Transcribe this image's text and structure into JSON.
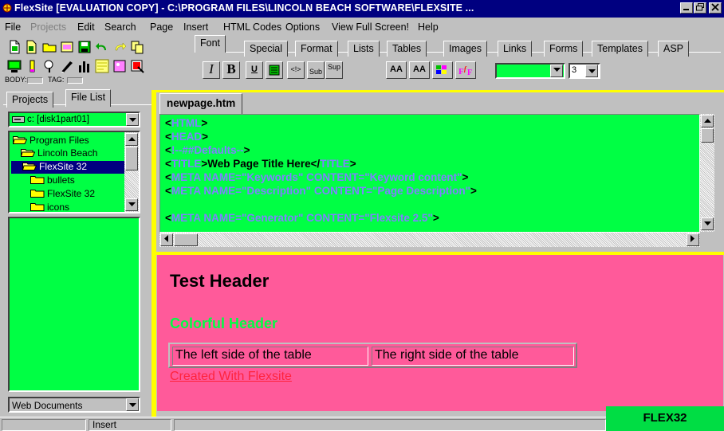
{
  "window": {
    "title": "FlexSite [EVALUATION COPY] - C:\\PROGRAM FILES\\LINCOLN BEACH SOFTWARE\\FLEXSITE ...",
    "controls": {
      "minimize": "_",
      "maximize": "❐",
      "close": "X"
    }
  },
  "menu": [
    "File",
    "Projects",
    "Edit",
    "Search",
    "Page",
    "Insert",
    "HTML Codes",
    "Options",
    "View Full Screen!",
    "Help"
  ],
  "toolbar": {
    "body_label": "BODY:",
    "tag_label": "TAG:",
    "tabs": [
      "Font",
      "Special",
      "Format",
      "Lists",
      "Tables",
      "Images",
      "Links",
      "Forms",
      "Templates",
      "ASP"
    ],
    "font_buttons": {
      "italic": "I",
      "bold": "B",
      "underline": "U",
      "comment": "<!>",
      "sub": "Sub",
      "sup": "Sup",
      "size_up": "AA",
      "size_down": "AA"
    },
    "font_size": "3"
  },
  "left_panel": {
    "tabs": [
      "Projects",
      "File List"
    ],
    "drive": "c: [disk1part01]",
    "folders": [
      "Program Files",
      "Lincoln Beach",
      "FlexSite 32",
      "bullets",
      "FlexSite 32",
      "icons"
    ],
    "filter": "Web Documents"
  },
  "editor": {
    "tab": "newpage.htm",
    "lines": [
      [
        {
          "t": "<",
          "c": "bk"
        },
        {
          "t": "HTML",
          "c": "tg"
        },
        {
          "t": ">",
          "c": "bk"
        }
      ],
      [
        {
          "t": "<",
          "c": "bk"
        },
        {
          "t": "HEAD",
          "c": "tg"
        },
        {
          "t": ">",
          "c": "bk"
        }
      ],
      [
        {
          "t": "<",
          "c": "bk"
        },
        {
          "t": "!--##Defaults--",
          "c": "tg"
        },
        {
          "t": ">",
          "c": "bk"
        }
      ],
      [
        {
          "t": "<",
          "c": "bk"
        },
        {
          "t": "TITLE",
          "c": "tg"
        },
        {
          "t": ">",
          "c": "bk"
        },
        {
          "t": "Web Page Title Here",
          "c": "bk"
        },
        {
          "t": "</",
          "c": "bk"
        },
        {
          "t": "TITLE",
          "c": "tg"
        },
        {
          "t": ">",
          "c": "bk"
        }
      ],
      [
        {
          "t": "<",
          "c": "bk"
        },
        {
          "t": "META NAME=\"Keywords\" CONTENT=\"Keyword content\"",
          "c": "tg"
        },
        {
          "t": ">",
          "c": "bk"
        }
      ],
      [
        {
          "t": "<",
          "c": "bk"
        },
        {
          "t": "META NAME=\"Description\" CONTENT=\"Page Description\"",
          "c": "tg"
        },
        {
          "t": ">",
          "c": "bk"
        }
      ],
      [],
      [
        {
          "t": "<",
          "c": "bk"
        },
        {
          "t": "META NAME=\"Generator\" CONTENT=\"Flexsite 2.5\"",
          "c": "tg"
        },
        {
          "t": ">",
          "c": "bk"
        }
      ]
    ]
  },
  "preview": {
    "header": "Test Header",
    "colorful_header": "Colorful Header",
    "table_cells": [
      "The left side of the table",
      "The right side of the table"
    ],
    "link": "Created With Flexsite"
  },
  "statusbar": {
    "mode": "Insert",
    "brand": "FLEX32"
  },
  "colors": {
    "title_bar": "#000080",
    "code_bg": "#00ff44",
    "preview_bg": "#ff5a9a",
    "tag_color": "#8080ff",
    "brand_bg": "#00dd44"
  }
}
